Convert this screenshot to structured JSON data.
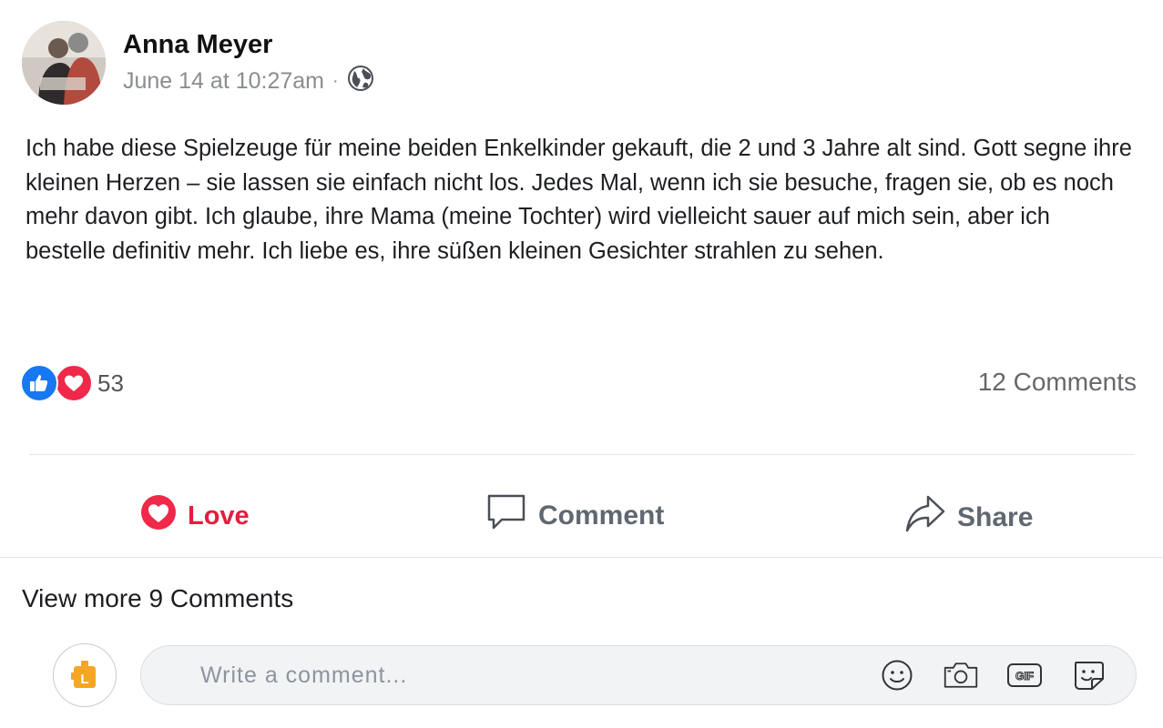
{
  "post": {
    "author": "Anna Meyer",
    "timestamp": "June 14 at 10:27am",
    "separator": "·",
    "privacy_icon": "globe-icon",
    "text": "Ich habe diese Spielzeuge für meine beiden Enkelkinder gekauft, die 2 und 3 Jahre alt sind. Gott segne ihre kleinen Herzen – sie lassen sie einfach nicht los. Jedes Mal, wenn ich sie besuche, fragen sie, ob es noch mehr davon gibt. Ich glaube, ihre Mama (meine Tochter) wird vielleicht sauer auf mich sein, aber ich bestelle definitiv mehr. Ich liebe es, ihre süßen kleinen Gesichter strahlen zu sehen."
  },
  "reactions": {
    "icons": [
      "like-icon",
      "heart-icon"
    ],
    "count": "53",
    "comments_label": "12 Comments"
  },
  "actions": {
    "love": "Love",
    "comment": "Comment",
    "share": "Share"
  },
  "comments": {
    "view_more": "View more 9 Comments",
    "placeholder": "Write a comment...",
    "icons": [
      "emoji-icon",
      "camera-icon",
      "gif-icon",
      "sticker-icon"
    ]
  },
  "colors": {
    "love_red": "#e41e3f",
    "like_blue": "#1877f2",
    "heart_red": "#f02849",
    "muted_text": "#65676b"
  }
}
